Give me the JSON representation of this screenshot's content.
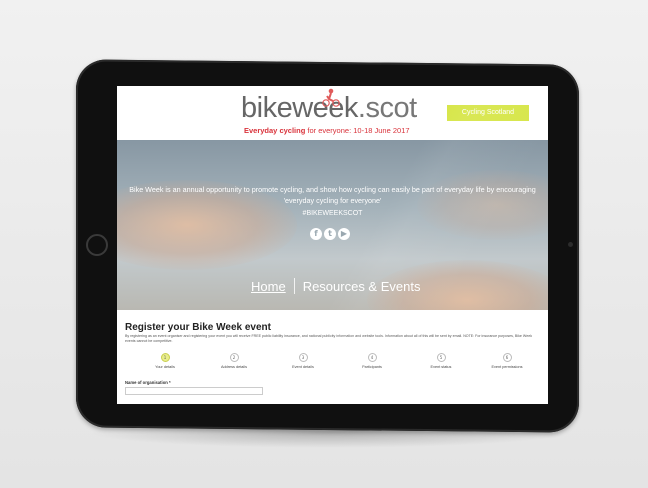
{
  "brand": {
    "logo_main": "bikeweek",
    "logo_suffix": ".scot",
    "tagline_bold": "Everyday cycling",
    "tagline_rest": " for everyone: 10-18 June 2017",
    "accent_red": "#d9323a",
    "accent_green": "#d7e64a"
  },
  "header": {
    "cycling_scotland_label": "Cycling Scotland"
  },
  "hero": {
    "intro": "Bike Week is an annual opportunity to promote cycling, and show how cycling can easily be part of everyday life by encouraging 'everyday cycling for everyone'",
    "hashtag": "#BIKEWEEKSCOT",
    "social": [
      {
        "icon": "facebook-icon",
        "glyph": "f"
      },
      {
        "icon": "twitter-icon",
        "glyph": "t"
      },
      {
        "icon": "youtube-icon",
        "glyph": "▶"
      }
    ]
  },
  "nav": {
    "home": "Home",
    "resources": "Resources & Events"
  },
  "register": {
    "title": "Register your Bike Week event",
    "description": "By registering as an event organiser and registering your event you will receive FREE public liability insurance, and national publicity information and website tools. Information about all of this will be sent by email. NOTE: For insurance purposes, Bike Week events cannot be competitive.",
    "steps": [
      {
        "num": "1",
        "label": "Your details",
        "active": true
      },
      {
        "num": "2",
        "label": "Address details",
        "active": false
      },
      {
        "num": "3",
        "label": "Event details",
        "active": false
      },
      {
        "num": "4",
        "label": "Participants",
        "active": false
      },
      {
        "num": "5",
        "label": "Event status",
        "active": false
      },
      {
        "num": "6",
        "label": "Event permissions",
        "active": false
      }
    ],
    "org_label": "Name of organisation *",
    "org_value": ""
  }
}
